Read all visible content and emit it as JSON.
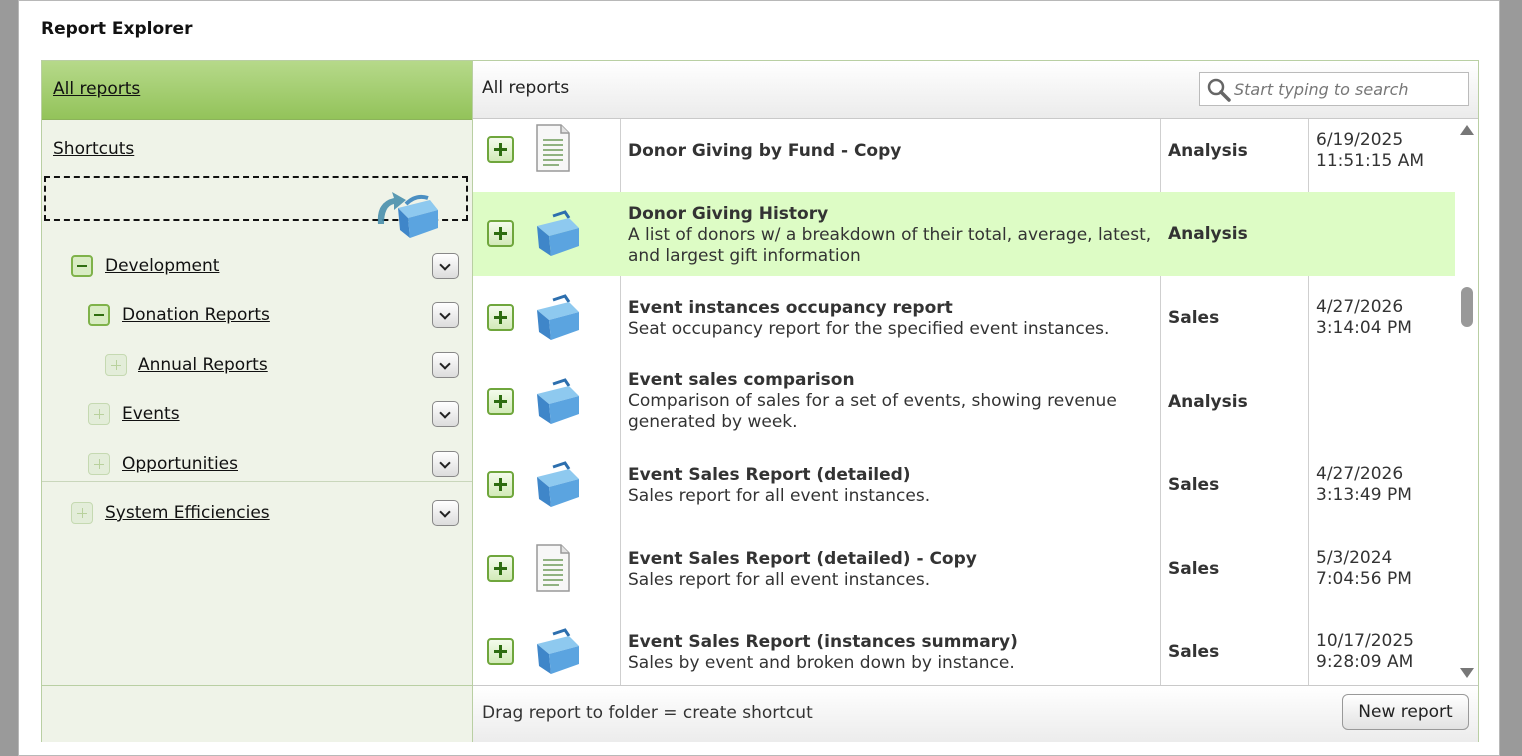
{
  "window_title": "Report Explorer",
  "left": {
    "all_reports": "All reports",
    "shortcuts": "Shortcuts",
    "tree": [
      {
        "label": "Development",
        "state": "expanded"
      },
      {
        "label": "Donation Reports",
        "state": "expanded"
      },
      {
        "label": "Annual Reports",
        "state": "collapsed"
      },
      {
        "label": "Events",
        "state": "collapsed"
      },
      {
        "label": "Opportunities",
        "state": "collapsed"
      },
      {
        "label": "System Efficiencies",
        "state": "collapsed"
      }
    ]
  },
  "right": {
    "breadcrumb": "All reports",
    "search": {
      "placeholder": "Start typing to search",
      "value": ""
    },
    "reports": [
      {
        "name": "Donor Giving by Fund - Copy",
        "description": "",
        "category": "Analysis",
        "date": "6/19/2025",
        "time": "11:51:15 AM",
        "icon": "document-icon"
      },
      {
        "name": "Donor Giving History",
        "description": "A list of donors w/ a breakdown of their total, average, latest, and largest gift information",
        "category": "Analysis",
        "date": "",
        "time": "",
        "icon": "toolbox-icon"
      },
      {
        "name": "Event instances occupancy report",
        "description": "Seat occupancy report for the specified event instances.",
        "category": "Sales",
        "date": "4/27/2026",
        "time": "3:14:04 PM",
        "icon": "toolbox-icon"
      },
      {
        "name": "Event sales comparison",
        "description": "Comparison of sales for a set of events, showing revenue generated by week.",
        "category": "Analysis",
        "date": "",
        "time": "",
        "icon": "toolbox-icon"
      },
      {
        "name": "Event Sales Report (detailed)",
        "description": "Sales report for all event instances.",
        "category": "Sales",
        "date": "4/27/2026",
        "time": "3:13:49 PM",
        "icon": "toolbox-icon"
      },
      {
        "name": "Event Sales Report (detailed) - Copy",
        "description": "Sales report for all event instances.",
        "category": "Sales",
        "date": "5/3/2024",
        "time": "7:04:56 PM",
        "icon": "document-icon"
      },
      {
        "name": "Event Sales Report (instances summary)",
        "description": "Sales by event and broken down by instance.",
        "category": "Sales",
        "date": "10/17/2025",
        "time": "9:28:09 AM",
        "icon": "toolbox-icon"
      }
    ],
    "footer_hint": "Drag report to folder = create shortcut",
    "new_report_label": "New report"
  },
  "colors": {
    "header_green": "#9cc862",
    "highlight_row": "#ddfcc5",
    "tree_bg": "#eff3e8"
  }
}
